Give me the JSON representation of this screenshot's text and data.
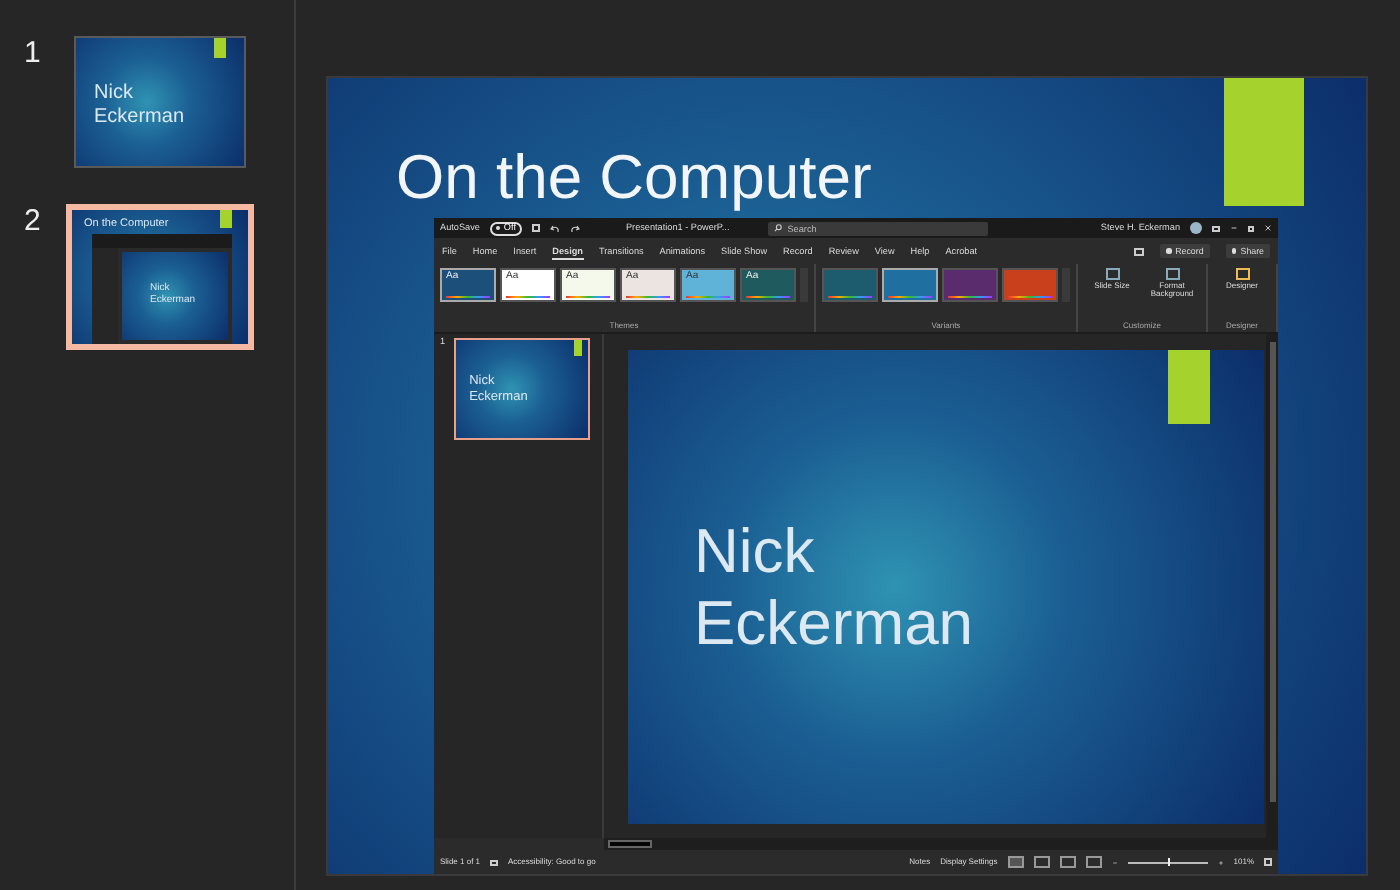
{
  "thumbnails": [
    {
      "number": "1",
      "selected": false,
      "kind": "title",
      "lines": [
        "Nick",
        "Eckerman"
      ]
    },
    {
      "number": "2",
      "selected": true,
      "kind": "screenshot",
      "title": "On the Computer",
      "lines": [
        "Nick",
        "Eckerman"
      ]
    }
  ],
  "slide": {
    "title": "On the Computer",
    "screenshot": {
      "titlebar": {
        "autosave": "AutoSave",
        "autosave_toggle": {
          "label": "Off",
          "on": false
        },
        "document": "Presentation1 - PowerP...",
        "search": {
          "placeholder": "Search"
        },
        "user": "Steve H. Eckerman"
      },
      "tabs": [
        {
          "label": "File",
          "selected": false
        },
        {
          "label": "Home",
          "selected": false
        },
        {
          "label": "Insert",
          "selected": false
        },
        {
          "label": "Design",
          "selected": true
        },
        {
          "label": "Transitions",
          "selected": false
        },
        {
          "label": "Animations",
          "selected": false
        },
        {
          "label": "Slide Show",
          "selected": false
        },
        {
          "label": "Record",
          "selected": false
        },
        {
          "label": "Review",
          "selected": false
        },
        {
          "label": "View",
          "selected": false
        },
        {
          "label": "Help",
          "selected": false
        },
        {
          "label": "Acrobat",
          "selected": false
        }
      ],
      "ribbon_buttons": [
        "Record",
        "Share"
      ],
      "themes": {
        "label": "Themes",
        "items": [
          {
            "text": "Aa",
            "selected": true,
            "color": "#1c4f7a"
          },
          {
            "text": "Aa",
            "selected": false,
            "color": "#ffffff"
          },
          {
            "text": "Aa",
            "selected": false,
            "color": "#f4f9ec"
          },
          {
            "text": "Aa",
            "selected": false,
            "color": "#ece4e0"
          },
          {
            "text": "Aa",
            "selected": false,
            "color": "#5fb3d9"
          },
          {
            "text": "Aa",
            "selected": false,
            "color": "#1e5a5e"
          }
        ]
      },
      "variants": {
        "label": "Variants",
        "items": [
          {
            "selected": false,
            "color": "#1d5b6e"
          },
          {
            "selected": true,
            "color": "#1f6fa0"
          },
          {
            "selected": false,
            "color": "#5a2c6e"
          },
          {
            "selected": false,
            "color": "#c8401c"
          }
        ]
      },
      "customize": {
        "label": "Customize",
        "buttons": [
          {
            "label": "Slide Size"
          },
          {
            "label": "Format Background"
          }
        ]
      },
      "designer": {
        "label": "Designer",
        "buttons": [
          {
            "label": "Designer"
          }
        ]
      },
      "thumbnail": {
        "number": "1",
        "selected": true,
        "lines": [
          "Nick",
          "Eckerman"
        ]
      },
      "slide_lines": [
        "Nick",
        "Eckerman"
      ],
      "status_bar": {
        "slide": "Slide 1 of 1",
        "accessibility": "Accessibility: Good to go",
        "notes": "Notes",
        "display": "Display Settings",
        "zoom": "101%",
        "zoom_slider": {
          "level": 0.5
        }
      }
    }
  }
}
